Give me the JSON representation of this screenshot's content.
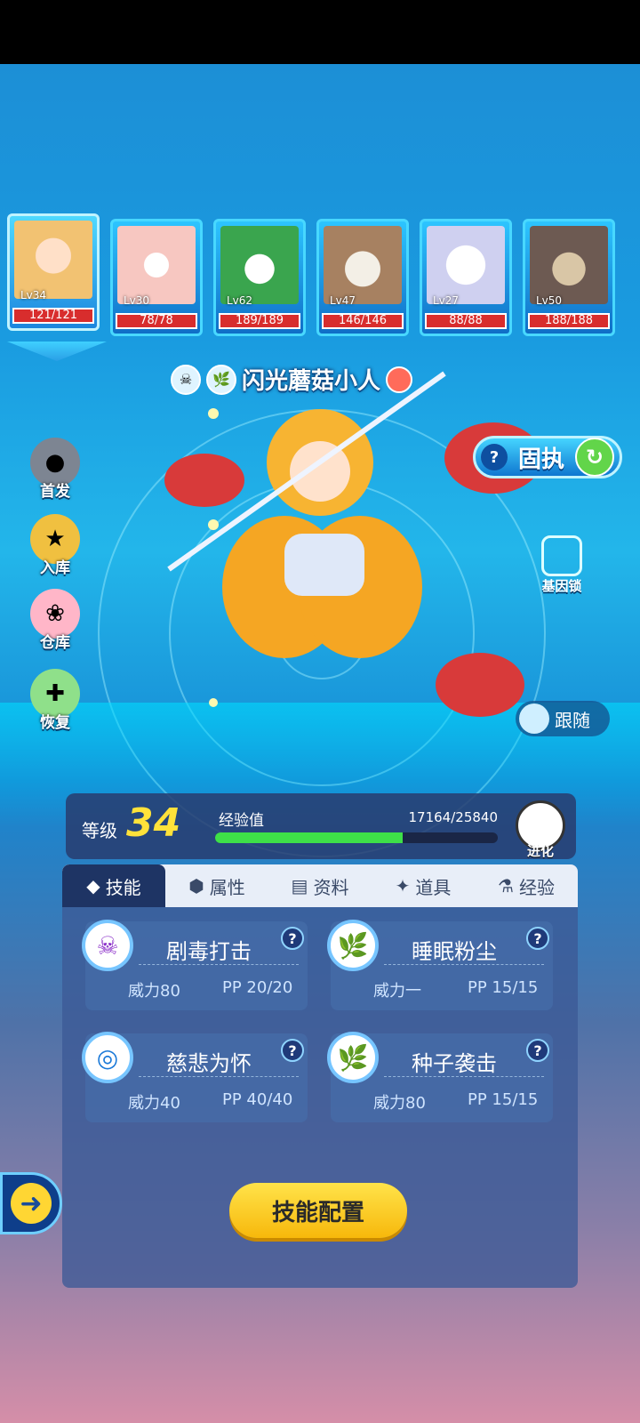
{
  "roster": [
    {
      "level": "Lv34",
      "hp": "121/121",
      "active": true,
      "color": "#f2c272"
    },
    {
      "level": "Lv30",
      "hp": "78/78",
      "active": false,
      "color": "#f7c7c1"
    },
    {
      "level": "Lv62",
      "hp": "189/189",
      "active": false,
      "color": "#3aa54e"
    },
    {
      "level": "Lv47",
      "hp": "146/146",
      "active": false,
      "color": "#a78161"
    },
    {
      "level": "Lv27",
      "hp": "88/88",
      "active": false,
      "color": "#e6e6f6"
    },
    {
      "level": "Lv50",
      "hp": "188/188",
      "active": false,
      "color": "#6d5a52"
    }
  ],
  "pet": {
    "name": "闪光蘑菇小人",
    "element_icons": [
      "poison-icon",
      "grass-icon"
    ],
    "nature": "固执"
  },
  "side_buttons": [
    {
      "label": "首发",
      "icon": "lineup-icon"
    },
    {
      "label": "入库",
      "icon": "store-icon"
    },
    {
      "label": "仓库",
      "icon": "warehouse-icon"
    },
    {
      "label": "恢复",
      "icon": "heal-icon"
    }
  ],
  "gene_lock_label": "基因锁",
  "follow_label": "跟随",
  "level": {
    "label": "等级",
    "value": "34",
    "exp_label": "经验值",
    "exp_text": "17164/25840",
    "exp_ratio": 0.664,
    "evolve_label": "进化"
  },
  "tabs": [
    {
      "label": "技能",
      "active": true
    },
    {
      "label": "属性",
      "active": false
    },
    {
      "label": "资料",
      "active": false
    },
    {
      "label": "道具",
      "active": false
    },
    {
      "label": "经验",
      "active": false
    }
  ],
  "skills": [
    {
      "name": "剧毒打击",
      "power": "威力80",
      "pp": "PP 20/20",
      "type": "poison"
    },
    {
      "name": "睡眠粉尘",
      "power": "威力一",
      "pp": "PP 15/15",
      "type": "grass"
    },
    {
      "name": "慈悲为怀",
      "power": "威力40",
      "pp": "PP 40/40",
      "type": "normal"
    },
    {
      "name": "种子袭击",
      "power": "威力80",
      "pp": "PP 15/15",
      "type": "grass"
    }
  ],
  "config_button": "技能配置",
  "colors": {
    "accent": "#ffd633",
    "hp": "#d82d2d",
    "exp": "#3ee048",
    "level": "#ffe23a"
  }
}
